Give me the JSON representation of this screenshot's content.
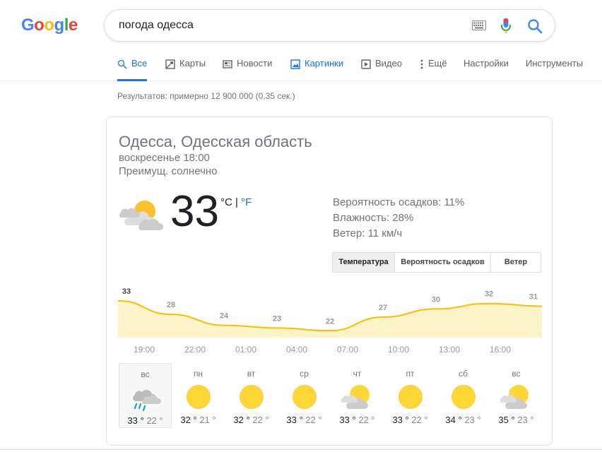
{
  "logo": {
    "text": "Google"
  },
  "search": {
    "query": "погода одесса"
  },
  "icons": {
    "keyboard": "keyboard-icon",
    "mic": "mic-icon",
    "search": "search-icon"
  },
  "tabs": [
    {
      "label": "Все",
      "icon": "search-icon"
    },
    {
      "label": "Карты",
      "icon": "map-icon"
    },
    {
      "label": "Новости",
      "icon": "news-icon"
    },
    {
      "label": "Картинки",
      "icon": "image-icon"
    },
    {
      "label": "Видео",
      "icon": "video-icon"
    },
    {
      "label": "Ещё",
      "icon": "more-icon"
    },
    {
      "label": "Настройки"
    },
    {
      "label": "Инструменты"
    }
  ],
  "results_stats": "Результатов: примерно 12 900 000 (0,35 сек.)",
  "weather": {
    "location": "Одесса, Одесская область",
    "datetime": "воскресенье 18:00",
    "condition": "Преимущ. солнечно",
    "temp": "33",
    "unit_c": "°C",
    "unit_sep": " | ",
    "unit_f": "°F",
    "precip": "Вероятность осадков: 11%",
    "humidity": "Влажность: 28%",
    "wind": "Ветер: 11 км/ч",
    "tabs": [
      "Температура",
      "Вероятность осадков",
      "Ветер"
    ]
  },
  "chart_data": {
    "type": "area",
    "x": [
      "19:00",
      "22:00",
      "01:00",
      "04:00",
      "07:00",
      "10:00",
      "13:00",
      "16:00"
    ],
    "values": [
      33,
      28,
      24,
      23,
      22,
      27,
      30,
      32,
      31
    ],
    "labels": [
      "33",
      "28",
      "24",
      "23",
      "22",
      "27",
      "30",
      "32",
      "31"
    ],
    "colors": {
      "line": "#fbbc04",
      "fill": "#fdf3c8"
    }
  },
  "forecast": [
    {
      "day": "вс",
      "hi": "33 °",
      "lo": "22 °",
      "icon": "rain-cloud-icon"
    },
    {
      "day": "пн",
      "hi": "32 °",
      "lo": "21 °",
      "icon": "sun-icon"
    },
    {
      "day": "вт",
      "hi": "32 °",
      "lo": "22 °",
      "icon": "sun-icon"
    },
    {
      "day": "ср",
      "hi": "33 °",
      "lo": "22 °",
      "icon": "sun-icon"
    },
    {
      "day": "чт",
      "hi": "33 °",
      "lo": "22 °",
      "icon": "partly-cloudy-icon"
    },
    {
      "day": "пт",
      "hi": "33 °",
      "lo": "22 °",
      "icon": "sun-icon"
    },
    {
      "day": "сб",
      "hi": "34 °",
      "lo": "23 °",
      "icon": "sun-icon"
    },
    {
      "day": "вс",
      "hi": "35 °",
      "lo": "23 °",
      "icon": "partly-cloudy-icon"
    }
  ]
}
